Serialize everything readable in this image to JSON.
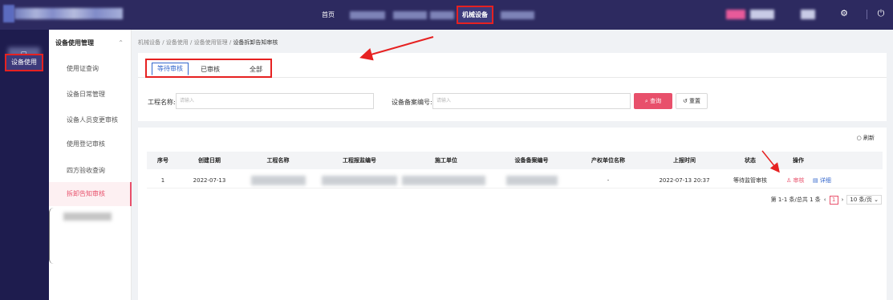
{
  "topbar": {
    "nav_home": "首页",
    "nav_active": "机械设备",
    "settings_icon": "gear-icon",
    "power_icon": "power-icon"
  },
  "rail": {
    "item_label": "设备使用",
    "item_icon": "monitor-icon"
  },
  "submenu": {
    "header": "设备使用管理",
    "items": [
      {
        "label": "使用证查询"
      },
      {
        "label": "设备日常管理"
      },
      {
        "label": "设备人员变更审核"
      },
      {
        "label": "使用登记审核"
      },
      {
        "label": "四方验收查询"
      },
      {
        "label": "拆卸告知审核"
      }
    ]
  },
  "breadcrumb": {
    "path": "机械设备 / 设备使用 / 设备使用管理 / ",
    "current": "设备拆卸告知审核"
  },
  "tabs": [
    {
      "label": "等待审核"
    },
    {
      "label": "已审核"
    },
    {
      "label": "全部"
    }
  ],
  "filters": {
    "project_label": "工程名称:",
    "project_placeholder": "请输入",
    "record_label": "设备备案编号:",
    "record_placeholder": "请输入",
    "query_button": "查询",
    "reset_button": "重置"
  },
  "table": {
    "refresh": "刷新",
    "columns": [
      "序号",
      "创建日期",
      "工程名称",
      "工程报监编号",
      "施工单位",
      "设备备案编号",
      "产权单位名称",
      "上报时间",
      "状态",
      "操作"
    ],
    "rows": [
      {
        "index": "1",
        "created": "2022-07-13",
        "owner": "-",
        "reported": "2022-07-13 20:37",
        "status": "等待监管审核",
        "audit": "审核",
        "detail": "详细"
      }
    ]
  },
  "pager": {
    "summary": "第 1-1 条/总共 1 条",
    "current": "1",
    "page_size": "10 条/页"
  },
  "colors": {
    "topbar": "#2d2a60",
    "accent": "#e8506b",
    "annotation": "#e62121",
    "link": "#3366cc"
  }
}
